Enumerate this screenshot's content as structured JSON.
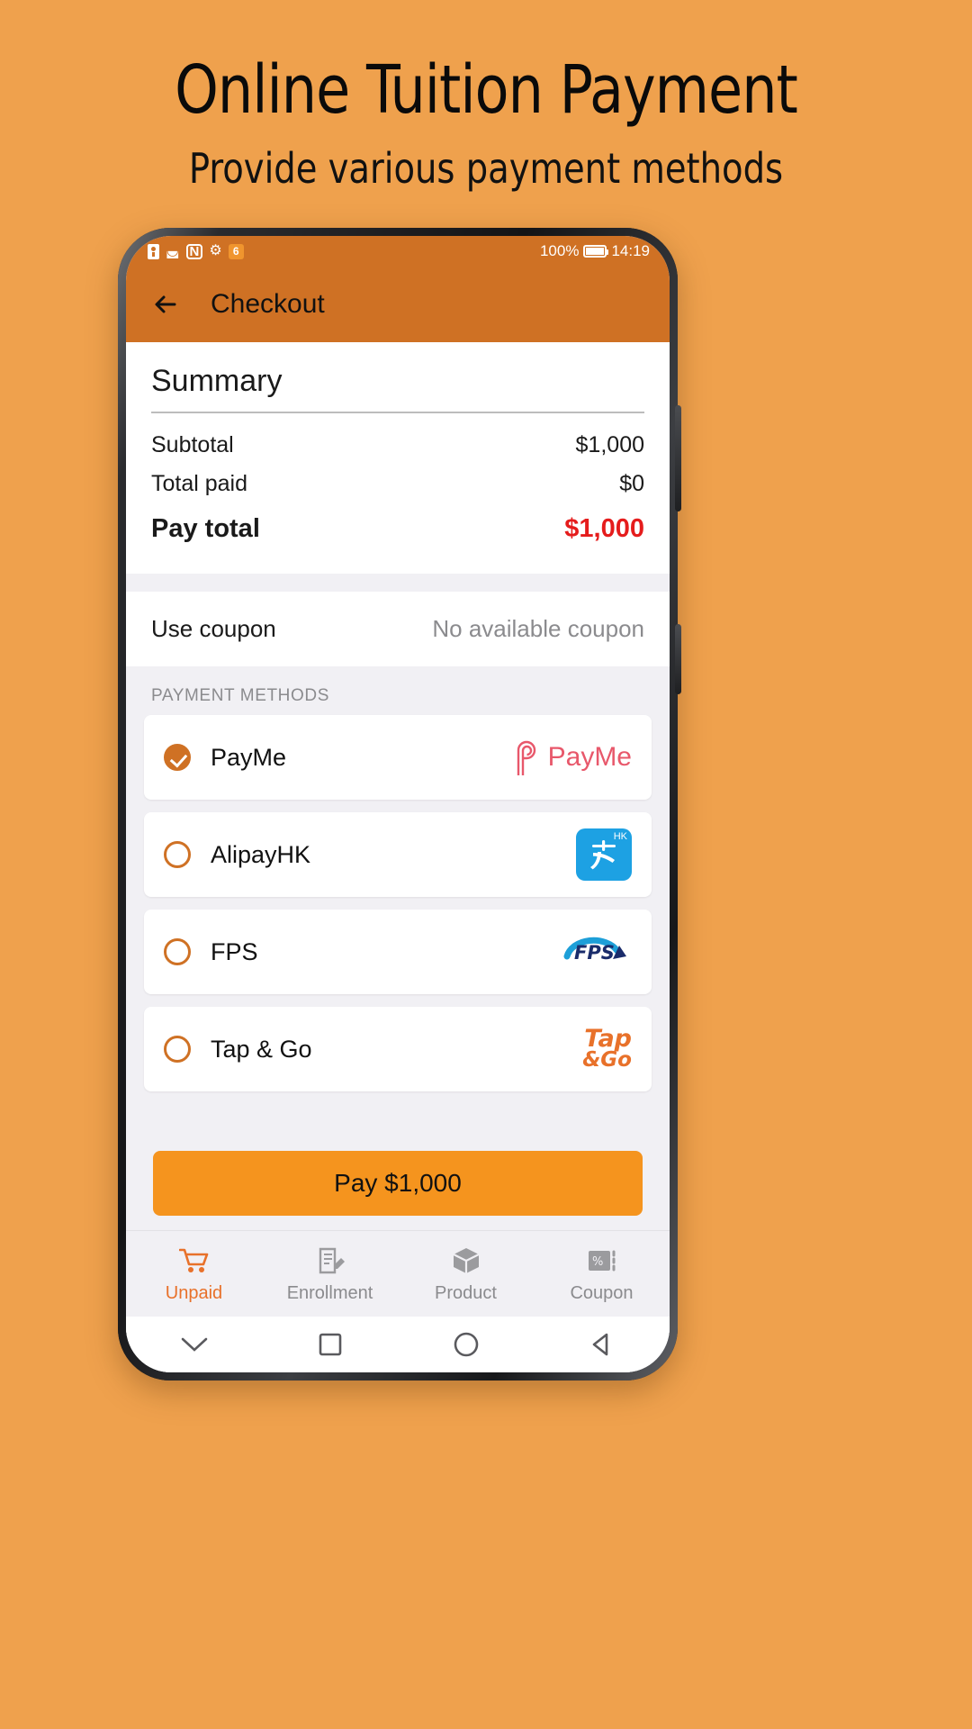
{
  "promo": {
    "title": "Online Tuition Payment",
    "subtitle": "Provide various payment methods",
    "background_color": "#efa14d"
  },
  "statusbar": {
    "battery_percent": "100%",
    "time": "14:19",
    "icons": [
      "sim-card-icon",
      "wifi-icon",
      "nfc-icon",
      "gear-icon",
      "app-badge-icon",
      "battery-icon"
    ]
  },
  "appbar": {
    "title": "Checkout",
    "back_label": "back-arrow",
    "color": "#cf7124"
  },
  "summary": {
    "title": "Summary",
    "rows": [
      {
        "label": "Subtotal",
        "amount": "$1,000"
      },
      {
        "label": "Total paid",
        "amount": "$0"
      }
    ],
    "total": {
      "label": "Pay total",
      "amount": "$1,000",
      "color": "#e51c1c"
    }
  },
  "coupon": {
    "label": "Use coupon",
    "value": "No available coupon"
  },
  "payment_methods": {
    "section_label": "PAYMENT METHODS",
    "selected": "PayMe",
    "items": [
      {
        "name": "PayMe",
        "selected": true,
        "logo": "payme-logo",
        "logo_text": "PayMe"
      },
      {
        "name": "AlipayHK",
        "selected": false,
        "logo": "alipayhk-logo",
        "logo_text": "HK"
      },
      {
        "name": "FPS",
        "selected": false,
        "logo": "fps-logo",
        "logo_text": "FPS"
      },
      {
        "name": "Tap & Go",
        "selected": false,
        "logo": "tapgo-logo",
        "logo_text": "Tap &Go"
      }
    ],
    "accent_color": "#cf7124"
  },
  "pay_button": {
    "label": "Pay $1,000",
    "color": "#f5941e"
  },
  "bottom_tabs": {
    "active": "Unpaid",
    "items": [
      {
        "label": "Unpaid",
        "icon": "shopping-cart-icon"
      },
      {
        "label": "Enrollment",
        "icon": "note-edit-icon"
      },
      {
        "label": "Product",
        "icon": "box-icon"
      },
      {
        "label": "Coupon",
        "icon": "percent-ticket-icon"
      }
    ],
    "active_color": "#e8712a",
    "inactive_color": "#8b8b8e"
  },
  "android_nav": {
    "buttons": [
      "chevron-down-icon",
      "square-icon",
      "circle-icon",
      "triangle-back-icon"
    ]
  }
}
